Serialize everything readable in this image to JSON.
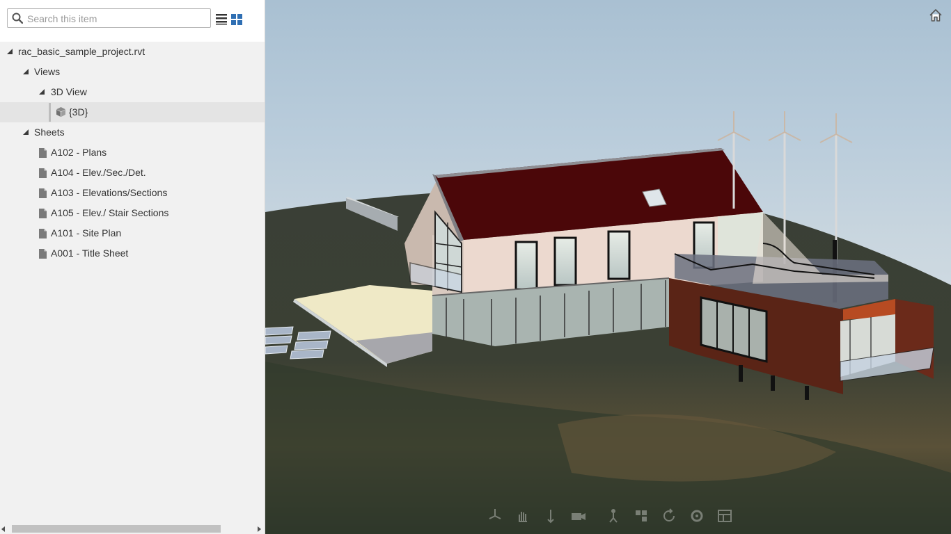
{
  "search": {
    "placeholder": "Search this item",
    "value": ""
  },
  "tree": {
    "root": {
      "label": "rac_basic_sample_project.rvt"
    },
    "views": {
      "label": "Views"
    },
    "view_3d_group": {
      "label": "3D View"
    },
    "view_3d_item": {
      "label": "{3D}"
    },
    "sheets": {
      "label": "Sheets",
      "items": [
        {
          "label": "A102 - Plans"
        },
        {
          "label": "A104 - Elev./Sec./Det."
        },
        {
          "label": "A103 - Elevations/Sections"
        },
        {
          "label": "A105 - Elev./ Stair Sections"
        },
        {
          "label": "A101 - Site Plan"
        },
        {
          "label": "A001 - Title Sheet"
        }
      ]
    }
  },
  "icons": {
    "search": "search-icon",
    "list_view": "list-view-icon",
    "grid_view": "grid-view-icon",
    "home": "home-icon",
    "cube": "cube-icon",
    "document": "document-icon"
  },
  "colors": {
    "sidebar_bg": "#f1f1f1",
    "selected_bg": "#e4e4e4",
    "accent_blue": "#2f6fb3",
    "roof_red": "#5c0a0e"
  }
}
